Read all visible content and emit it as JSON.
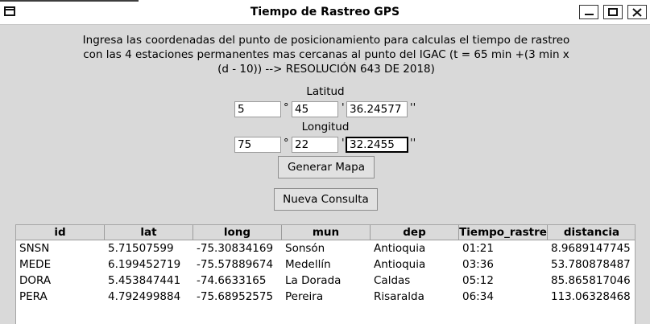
{
  "window": {
    "title": "Tiempo de Rastreo GPS"
  },
  "description": [
    "Ingresa las coordenadas del punto de posicionamiento para calculas el tiempo de rastreo",
    "con las 4 estaciones permanentes mas cercanas al punto del IGAC (t = 65 min +(3 min x",
    "(d - 10)) --> RESOLUCIÓN 643 DE 2018)"
  ],
  "latitude": {
    "label": "Latitud",
    "degrees": "5",
    "minutes": "45",
    "seconds": "36.24577"
  },
  "longitude": {
    "label": "Longitud",
    "degrees": "75",
    "minutes": "22",
    "seconds": "32.2455"
  },
  "symbols": {
    "degree": "°",
    "minute": "'",
    "second": "''"
  },
  "buttons": {
    "generate_map": "Generar Mapa",
    "new_query": "Nueva Consulta"
  },
  "table": {
    "columns": [
      "id",
      "lat",
      "long",
      "mun",
      "dep",
      "Tiempo_rastre",
      "distancia"
    ],
    "rows": [
      [
        "SNSN",
        "5.71507599",
        "-75.30834169",
        "Sonsón",
        "Antioquia",
        "01:21",
        "8.9689147745"
      ],
      [
        "MEDE",
        "6.199452719",
        "-75.57889674",
        "Medellín",
        "Antioquia",
        "03:36",
        "53.780878487"
      ],
      [
        "DORA",
        "5.453847441",
        "-74.6633165",
        "La Dorada",
        "Caldas",
        "05:12",
        "85.865817046"
      ],
      [
        "PERA",
        "4.792499884",
        "-75.68952575",
        "Pereira",
        "Risaralda",
        "06:34",
        "113.06328468"
      ]
    ]
  }
}
